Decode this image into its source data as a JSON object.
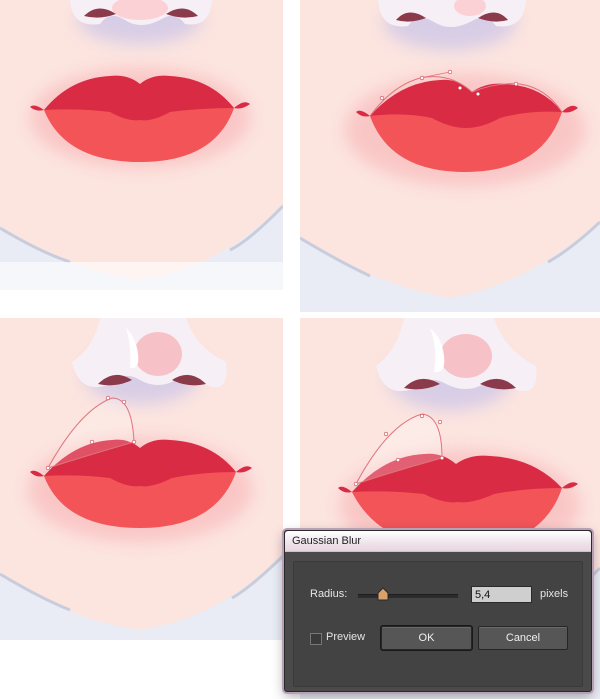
{
  "dialog": {
    "title": "Gaussian Blur",
    "radius_label": "Radius:",
    "radius_value": "5,4",
    "unit": "pixels",
    "preview_label": "Preview",
    "preview_checked": false,
    "ok_label": "OK",
    "cancel_label": "Cancel"
  },
  "colors": {
    "skin": "#fce4df",
    "lip_upper": "#d92b44",
    "lip_lower": "#f25458",
    "shirt": "#e9ecf4",
    "nose_shadow": "#d8cde6",
    "dialog_bg": "#4a4a4a"
  }
}
